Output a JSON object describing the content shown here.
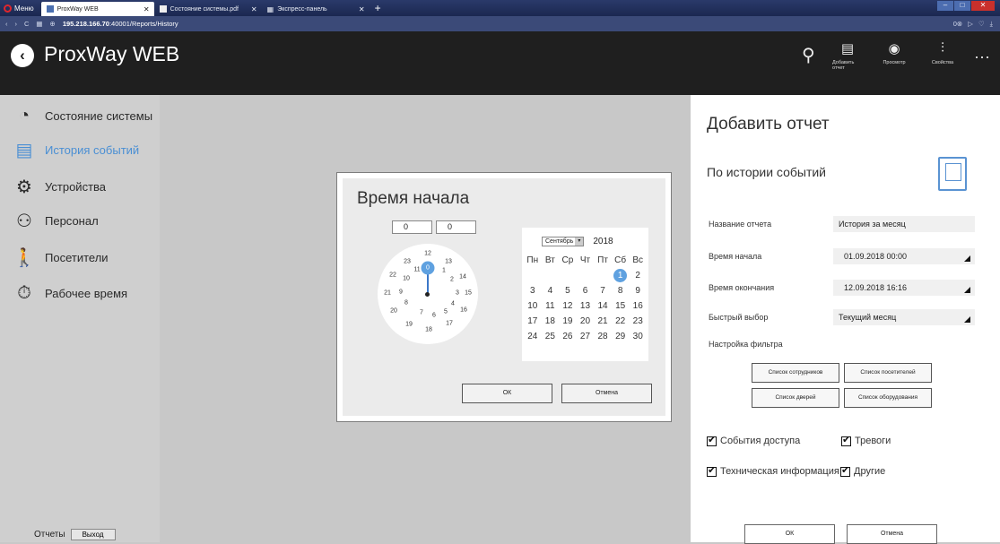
{
  "browser": {
    "menu_label": "Меню",
    "tabs": [
      {
        "label": "ProxWay WEB"
      },
      {
        "label": "Состояние системы.pdf"
      },
      {
        "label": "Экспресс-панель"
      }
    ],
    "url_host": "195.218.166.70",
    "url_rest": ":40001/Reports/History"
  },
  "app": {
    "title": "ProxWay WEB",
    "toolbar": {
      "add_report_label": "Добавить отчет",
      "preview_label": "Просмотр",
      "properties_label": "Свойства"
    }
  },
  "sidebar": {
    "items": [
      {
        "label": "Состояние системы",
        "icon": "gauge-icon"
      },
      {
        "label": "История событий",
        "icon": "history-icon"
      },
      {
        "label": "Устройства",
        "icon": "gear-icon"
      },
      {
        "label": "Персонал",
        "icon": "staff-icon"
      },
      {
        "label": "Посетители",
        "icon": "visitor-icon"
      },
      {
        "label": "Рабочее время",
        "icon": "worktime-icon"
      }
    ],
    "footer_reports": "Отчеты",
    "footer_exit": "Выход"
  },
  "time_dialog": {
    "title": "Время начала",
    "hours_value": "0",
    "minutes_value": "0",
    "clock_numbers": [
      "0",
      "1",
      "2",
      "3",
      "4",
      "5",
      "6",
      "7",
      "8",
      "9",
      "10",
      "11",
      "12",
      "13",
      "14",
      "15",
      "16",
      "17",
      "18",
      "19",
      "20",
      "21",
      "22",
      "23"
    ],
    "selected_hour": "0",
    "calendar": {
      "month": "Сентябрь",
      "year": "2018",
      "weekdays": [
        "Пн",
        "Вт",
        "Ср",
        "Чт",
        "Пт",
        "Сб",
        "Вс"
      ],
      "days": [
        "",
        "",
        "",
        "",
        "",
        "1",
        "2",
        "3",
        "4",
        "5",
        "6",
        "7",
        "8",
        "9",
        "10",
        "11",
        "12",
        "13",
        "14",
        "15",
        "16",
        "17",
        "18",
        "19",
        "20",
        "21",
        "22",
        "23",
        "24",
        "25",
        "26",
        "27",
        "28",
        "29",
        "30"
      ],
      "selected_day": "1"
    },
    "ok_label": "ОК",
    "cancel_label": "Отмена"
  },
  "panel": {
    "title": "Добавить отчет",
    "subtitle": "По истории событий",
    "fields": {
      "name_label": "Название отчета",
      "name_value": "История за месяц",
      "start_label": "Время начала",
      "start_value": "01.09.2018 00:00",
      "end_label": "Время окончания",
      "end_value": "12.09.2018 16:16",
      "quick_label": "Быстрый выбор",
      "quick_value": "Текущий месяц"
    },
    "filter_label": "Настройка фильтра",
    "filter_buttons": {
      "employees": "Список сотрудников",
      "visitors": "Список посетителей",
      "doors": "Список дверей",
      "equipment": "Список оборудования"
    },
    "checkboxes": {
      "access": "События доступа",
      "alarms": "Тревоги",
      "tech": "Техническая информация",
      "other": "Другие"
    },
    "ok_label": "ОК",
    "cancel_label": "Отмена"
  }
}
